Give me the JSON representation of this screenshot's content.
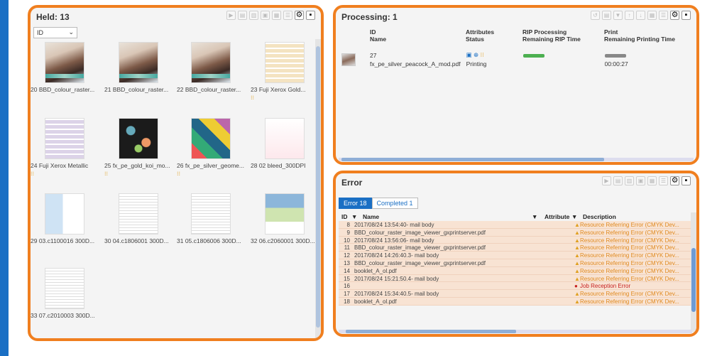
{
  "held": {
    "title": "Held: 13",
    "sort_value": "ID",
    "items": [
      {
        "label": "20 BBD_colour_raster...",
        "kind": "photo",
        "badge": ""
      },
      {
        "label": "21 BBD_colour_raster...",
        "kind": "photo",
        "badge": ""
      },
      {
        "label": "22 BBD_colour_raster...",
        "kind": "photo",
        "badge": ""
      },
      {
        "label": "23 Fuji Xerox Gold...",
        "kind": "swatch",
        "badge": "⁝⁝"
      },
      {
        "label": "24 Fuji Xerox Metallic",
        "kind": "swatch2",
        "badge": "⁝⁝"
      },
      {
        "label": "25 fx_pe_gold_koi_mo...",
        "kind": "dark",
        "badge": "⁝⁝"
      },
      {
        "label": "26 fx_pe_silver_geome...",
        "kind": "geo",
        "badge": "⁝⁝"
      },
      {
        "label": "28 02 bleed_300DPI",
        "kind": "bled",
        "badge": ""
      },
      {
        "label": "29 03.c1100016 300D...",
        "kind": "brochure",
        "badge": ""
      },
      {
        "label": "30 04.c1806001 300D...",
        "kind": "doc",
        "badge": ""
      },
      {
        "label": "31 05.c1806006 300D...",
        "kind": "doc",
        "badge": ""
      },
      {
        "label": "32 06.c2060001 300D...",
        "kind": "map",
        "badge": ""
      },
      {
        "label": "33 07.c2010003 300D...",
        "kind": "doc",
        "badge": ""
      }
    ]
  },
  "processing": {
    "title": "Processing: 1",
    "columns": {
      "id": "ID",
      "name": "Name",
      "attributes": "Attributes",
      "status": "Status",
      "rip": "RIP Processing",
      "rip_time": "Remaining RIP Time",
      "print": "Print",
      "print_time": "Remaining Printing Time"
    },
    "job": {
      "id": "27",
      "name": "fx_pe_silver_peacock_A_mod.pdf",
      "status": "Printing",
      "print_time": "00:00:27"
    }
  },
  "error": {
    "title": "Error",
    "tabs": [
      {
        "label": "Error 18",
        "active": true
      },
      {
        "label": "Completed 1",
        "active": false
      }
    ],
    "columns": {
      "id": "ID",
      "name": "Name",
      "attributes": "Attribute",
      "description": "Description"
    },
    "rows": [
      {
        "id": "8",
        "name": "2017/08/24 13:54:40- mail body",
        "desc": "Resource Referring Error (CMYK Dev...",
        "type": "warn"
      },
      {
        "id": "9",
        "name": "BBD_colour_raster_image_viewer_gxprintserver.pdf",
        "desc": "Resource Referring Error (CMYK Dev...",
        "type": "warn"
      },
      {
        "id": "10",
        "name": "2017/08/24 13:56:06- mail body",
        "desc": "Resource Referring Error (CMYK Dev...",
        "type": "warn"
      },
      {
        "id": "11",
        "name": "BBD_colour_raster_image_viewer_gxprintserver.pdf",
        "desc": "Resource Referring Error (CMYK Dev...",
        "type": "warn"
      },
      {
        "id": "12",
        "name": "2017/08/24 14:26:40.3- mail body",
        "desc": "Resource Referring Error (CMYK Dev...",
        "type": "warn"
      },
      {
        "id": "13",
        "name": "BBD_colour_raster_image_viewer_gxprintserver.pdf",
        "desc": "Resource Referring Error (CMYK Dev...",
        "type": "warn"
      },
      {
        "id": "14",
        "name": "booklet_A_ol.pdf",
        "desc": "Resource Referring Error (CMYK Dev...",
        "type": "warn"
      },
      {
        "id": "15",
        "name": "2017/08/24 15:21:50.4- mail body",
        "desc": "Resource Referring Error (CMYK Dev...",
        "type": "warn"
      },
      {
        "id": "16",
        "name": "",
        "desc": "Job Reception Error",
        "type": "error"
      },
      {
        "id": "17",
        "name": "2017/08/24 15:34:40.5- mail body",
        "desc": "Resource Referring Error (CMYK Dev...",
        "type": "warn"
      },
      {
        "id": "18",
        "name": "booklet_A_ol.pdf",
        "desc": "Resource Referring Error (CMYK Dev...",
        "type": "warn"
      }
    ]
  },
  "colors": {
    "highlight": "#f07f1f",
    "accent": "#1a6fc4"
  }
}
